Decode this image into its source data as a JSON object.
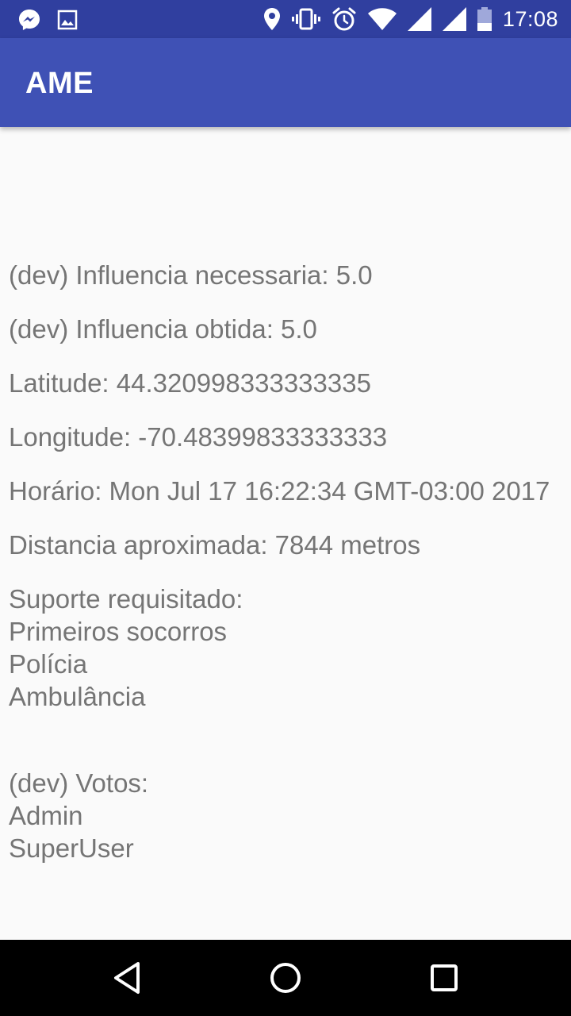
{
  "status_bar": {
    "time": "17:08",
    "left_icons": [
      "messenger-icon",
      "image-icon"
    ],
    "right_icons": [
      "location-icon",
      "vibrate-icon",
      "alarm-icon",
      "wifi-icon",
      "signal-icon",
      "signal-icon",
      "battery-icon"
    ]
  },
  "app_bar": {
    "title": "AME"
  },
  "details": {
    "influence_required": "(dev) Influencia necessaria: 5.0",
    "influence_obtained": "(dev) Influencia obtida: 5.0",
    "latitude": "Latitude: 44.320998333333335",
    "longitude": "Longitude: -70.48399833333333",
    "time": "Horário: Mon Jul 17 16:22:34 GMT-03:00 2017",
    "distance": "Distancia aproximada: 7844 metros",
    "support_label": "Suporte requisitado:",
    "support_items": [
      "Primeiros socorros",
      "Polícia",
      "Ambulância"
    ],
    "votes_label": "(dev) Votos:",
    "votes_items": [
      "Admin",
      "SuperUser"
    ]
  },
  "nav_bar": {
    "buttons": [
      "back-icon",
      "home-icon",
      "recents-icon"
    ]
  }
}
